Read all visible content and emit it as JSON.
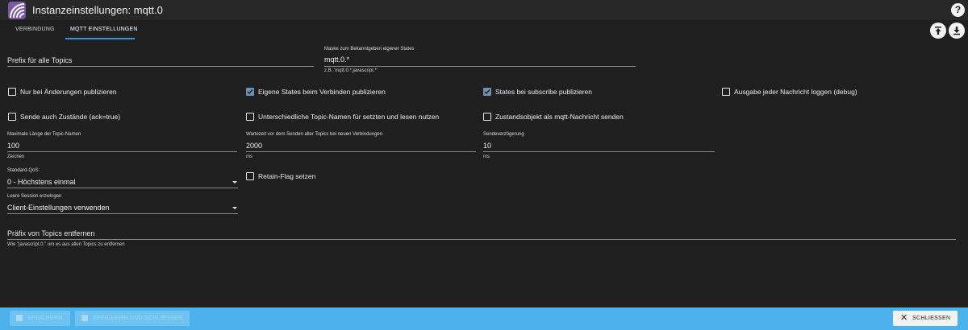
{
  "window": {
    "title": "Instanzeinstellungen: mqtt.0",
    "help": "?"
  },
  "tabs": [
    {
      "label": "VERBINDUNG",
      "active": false
    },
    {
      "label": "MQTT EINSTELLUNGEN",
      "active": true
    }
  ],
  "fields": {
    "prefix": {
      "label": "Prefix für alle Topics",
      "value": ""
    },
    "mask": {
      "label": "Maske zum Bekanntgeben eigener States",
      "value": "mqtt.0.*",
      "helper": "z.B. 'mqtt.0.*,javascript.*'"
    },
    "maxlen": {
      "label": "Maximale Länge der Topic-Namen",
      "value": "100",
      "helper": "Zeichen"
    },
    "wait": {
      "label": "Wartezeit vor dem Senden aller Topics bei neuen Verbindungen",
      "value": "2000",
      "helper": "ms"
    },
    "delay": {
      "label": "Sendeverzögerung",
      "value": "10",
      "helper": "ms"
    },
    "qos": {
      "label": "Standard-QoS:",
      "value": "0 - Höchstens einmal"
    },
    "session": {
      "label": "Leere Session erzwingen",
      "value": "Client-Einstellungen verwenden"
    },
    "remove_prefix": {
      "label": "Präfix von Topics entfernen",
      "value": "",
      "helper": "Wie \"javascript.0.\" um es aus allen Topics zu entfernen"
    }
  },
  "checkboxes": {
    "only_changes": {
      "label": "Nur bei Änderungen publizieren",
      "checked": false
    },
    "own_states": {
      "label": "Eigene States beim Verbinden publizieren",
      "checked": true
    },
    "on_subscribe": {
      "label": "States bei subscribe publizieren",
      "checked": true
    },
    "log_each": {
      "label": "Ausgabe jeder Nachricht loggen (debug)",
      "checked": false
    },
    "send_ack": {
      "label": "Sende auch Zustände (ack=true)",
      "checked": false
    },
    "diff_topics": {
      "label": "Unterschiedliche Topic-Namen für setzten und lesen nutzen",
      "checked": false
    },
    "state_object": {
      "label": "Zustandsobjekt als mqtt-Nachricht senden",
      "checked": false
    },
    "retain": {
      "label": "Retain-Flag setzen",
      "checked": false
    }
  },
  "footer": {
    "save": "SPEICHERN",
    "save_close": "SPEICHERN UND SCHLIESSEN",
    "close": "SCHLIESSEN",
    "close_icon": "✕"
  },
  "colors": {
    "accent": "#4db2ec",
    "tab_indicator": "#3399cc",
    "checked": "#6f8fb3"
  }
}
